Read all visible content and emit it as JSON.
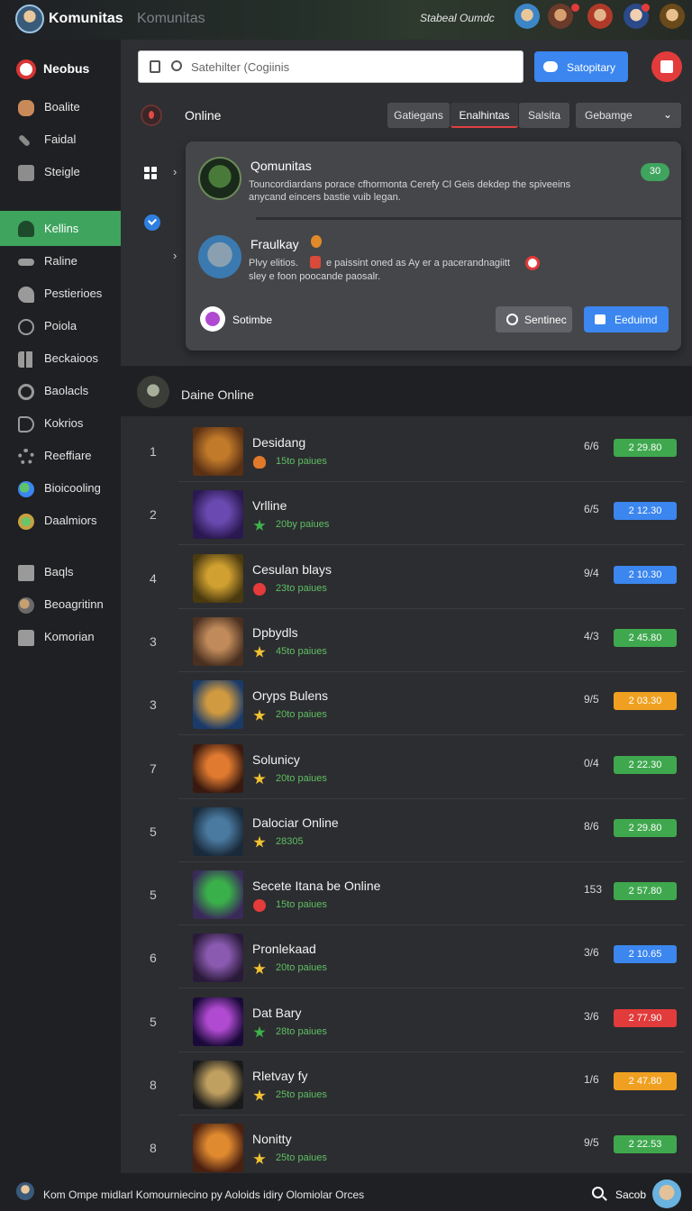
{
  "header": {
    "brand": "Komunitas",
    "brand_secondary": "Komunitas",
    "status_text": "Stabeal Oumdc"
  },
  "search": {
    "placeholder": "Satehilter (Cogiinis"
  },
  "toolbar": {
    "primary_label": "Satopitary"
  },
  "sidebar": {
    "top_label": "Neobus",
    "items": [
      {
        "label": "Boalite",
        "icon": "bottle-icon"
      },
      {
        "label": "Faidal",
        "icon": "wrench-icon"
      },
      {
        "label": "Steigle",
        "icon": "chat-icon"
      },
      {
        "label": "Kellins",
        "icon": "user-icon"
      },
      {
        "label": "Raline",
        "icon": "link-icon"
      },
      {
        "label": "Pestierioes",
        "icon": "key-icon"
      },
      {
        "label": "Poiola",
        "icon": "coin-icon"
      },
      {
        "label": "Beckaioos",
        "icon": "grid-icon"
      },
      {
        "label": "Baolacls",
        "icon": "circle-icon"
      },
      {
        "label": "Kokrios",
        "icon": "tag-icon"
      },
      {
        "label": "Reeffiare",
        "icon": "gear-icon"
      },
      {
        "label": "Bioicooling",
        "icon": "globe-icon"
      },
      {
        "label": "Daalmiors",
        "icon": "leaf-icon"
      },
      {
        "label": "Baqls",
        "icon": "document-icon"
      },
      {
        "label": "Beoagritinn",
        "icon": "globe-icon"
      },
      {
        "label": "Komorian",
        "icon": "bag-icon"
      }
    ]
  },
  "online": {
    "title": "Online",
    "tabs": [
      "Gatiegans",
      "Enalhintas",
      "Salsita"
    ],
    "active_tab": "Enalhintas",
    "dropdown": "Gebamge"
  },
  "card": {
    "post1": {
      "title": "Qomunitas",
      "text": "Touncordiardans porace cfhormonta Cerefy Cl Geis dekdep the spiveeins anycand eincers bastie vuib legan.",
      "pill": "30"
    },
    "post2": {
      "title": "Fraulkay",
      "text_a": "Plvy elitios.",
      "text_b": "e paissint oned as Ay er a pacerandnagiitt",
      "text_c": "sley e foon poocande paosalr."
    },
    "subscribe_label": "Sotimbe",
    "secondary_button": "Sentinec",
    "primary_button": "Eeduimd"
  },
  "section": {
    "title": "Daine Online"
  },
  "games": [
    {
      "rank": "1",
      "name": "Desidang",
      "meta": "15to paiues",
      "meta_icon": "flame-icon",
      "score": "6/6",
      "price": "2 29.80",
      "price_color": "#3fa84e",
      "thumb": [
        "#c07a2a",
        "#5a3014"
      ]
    },
    {
      "rank": "2",
      "name": "Vrlline",
      "meta": "20by paiues",
      "meta_icon": "green-star-icon",
      "score": "6/5",
      "price": "2 12.30",
      "price_color": "#3b86ef",
      "thumb": [
        "#6a4ab0",
        "#2a1850"
      ]
    },
    {
      "rank": "4",
      "name": "Cesulan blays",
      "meta": "23to paiues",
      "meta_icon": "heart-icon",
      "score": "9/4",
      "price": "2 10.30",
      "price_color": "#3b86ef",
      "thumb": [
        "#d0a030",
        "#4a3a10"
      ]
    },
    {
      "rank": "3",
      "name": "Dpbydls",
      "meta": "45to paiues",
      "meta_icon": "star-icon",
      "score": "4/3",
      "price": "2 45.80",
      "price_color": "#3fa84e",
      "thumb": [
        "#c08a5a",
        "#4a3020"
      ]
    },
    {
      "rank": "3",
      "name": "Oryps Bulens",
      "meta": "20to paiues",
      "meta_icon": "star-icon",
      "score": "9/5",
      "price": "2 03.30",
      "price_color": "#f0a020",
      "thumb": [
        "#d09a40",
        "#1a3a6a"
      ]
    },
    {
      "rank": "7",
      "name": "Solunicy",
      "meta": "20to paiues",
      "meta_icon": "star-icon",
      "score": "0/4",
      "price": "2 22.30",
      "price_color": "#3fa84e",
      "thumb": [
        "#e07a30",
        "#3a1a10"
      ]
    },
    {
      "rank": "5",
      "name": "Dalociar Online",
      "meta": "28305",
      "meta_icon": "star-icon",
      "score": "8/6",
      "price": "2 29.80",
      "price_color": "#3fa84e",
      "thumb": [
        "#4a7aa0",
        "#1a2a3a"
      ]
    },
    {
      "rank": "5",
      "name": "Secete Itana be Online",
      "meta": "15to paiues",
      "meta_icon": "heart-icon",
      "score": "153",
      "price": "2 57.80",
      "price_color": "#3fa84e",
      "thumb": [
        "#3ab04a",
        "#3a2a5a"
      ]
    },
    {
      "rank": "6",
      "name": "Pronlekaad",
      "meta": "20to paiues",
      "meta_icon": "star-icon",
      "score": "3/6",
      "price": "2 10.65",
      "price_color": "#3b86ef",
      "thumb": [
        "#8a5ab0",
        "#2a1a3a"
      ]
    },
    {
      "rank": "5",
      "name": "Dat Bary",
      "meta": "28to paiues",
      "meta_icon": "green-star-icon",
      "score": "3/6",
      "price": "2 77.90",
      "price_color": "#e23b3b",
      "thumb": [
        "#b04ad0",
        "#1a0a3a"
      ]
    },
    {
      "rank": "8",
      "name": "Rletvay fy",
      "meta": "25to paiues",
      "meta_icon": "star-icon",
      "score": "1/6",
      "price": "2 47.80",
      "price_color": "#f0a020",
      "thumb": [
        "#c0a060",
        "#1a1a1a"
      ]
    },
    {
      "rank": "8",
      "name": "Nonitty",
      "meta": "25to paiues",
      "meta_icon": "star-icon",
      "score": "9/5",
      "price": "2 22.53",
      "price_color": "#3fa84e",
      "thumb": [
        "#e08a30",
        "#4a2010"
      ]
    }
  ],
  "footer": {
    "text": "Kom Ompe midlarl Komourniecino py Aoloids idiry Olomiolar Orces",
    "search_label": "Sacob"
  }
}
